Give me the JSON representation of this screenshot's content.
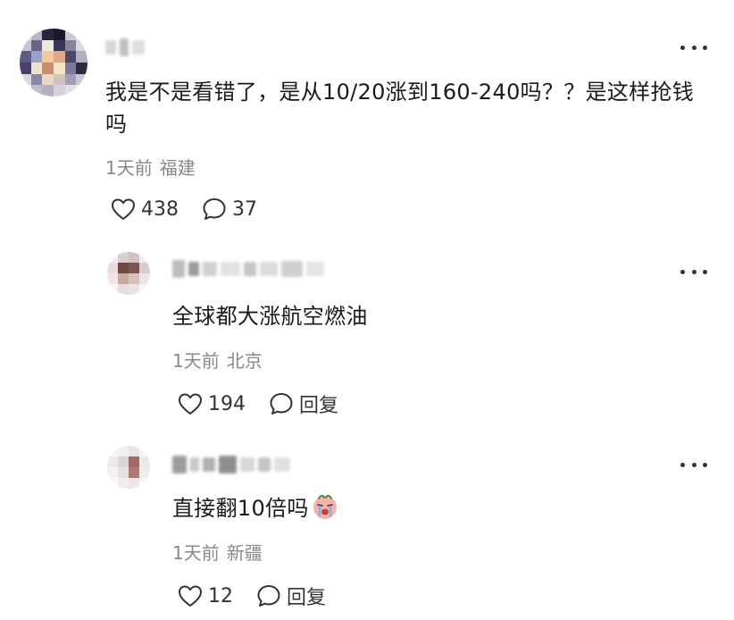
{
  "comments": [
    {
      "text": "我是不是看错了，是从10/20涨到160-240吗？？是这样抢钱吗",
      "time": "1天前",
      "location": "福建",
      "likes": "438",
      "replies": "37",
      "like_icon": "heart-outline-icon",
      "reply_icon": "speech-bubble-icon",
      "more_icon": "more-horizontal-icon"
    }
  ],
  "replies": [
    {
      "text": "全球都大涨航空燃油",
      "time": "1天前",
      "location": "北京",
      "likes": "194",
      "reply_label": "回复"
    },
    {
      "text": "直接翻10倍吗",
      "emoji": "crying-face-emoji",
      "time": "1天前",
      "location": "新疆",
      "likes": "12",
      "reply_label": "回复"
    }
  ],
  "colors": {
    "text": "#1a1a1a",
    "meta": "#888888",
    "icon": "#333333",
    "background": "#ffffff"
  }
}
